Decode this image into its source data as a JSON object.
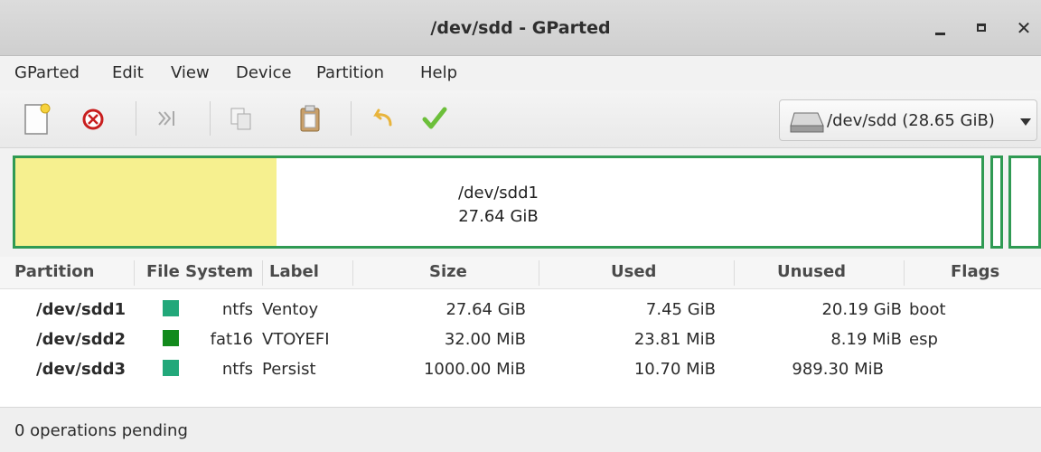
{
  "window": {
    "title": "/dev/sdd - GParted"
  },
  "menu": [
    "GParted",
    "Edit",
    "View",
    "Device",
    "Partition",
    "Help"
  ],
  "toolbar": {
    "buttons": [
      "new-icon",
      "delete-icon",
      "resize-move-icon",
      "copy-icon",
      "paste-icon",
      "undo-icon",
      "apply-icon"
    ],
    "device": "/dev/sdd (28.65 GiB)"
  },
  "graph": {
    "main": {
      "name": "/dev/sdd1",
      "size": "27.64 GiB",
      "used_fraction": 0.27
    }
  },
  "table": {
    "headers": [
      "Partition",
      "File System",
      "Label",
      "Size",
      "Used",
      "Unused",
      "Flags"
    ],
    "rows": [
      {
        "partition": "/dev/sdd1",
        "fs": "ntfs",
        "fs_color": "#22a87a",
        "label": "Ventoy",
        "size": "27.64 GiB",
        "used": "7.45 GiB",
        "unused": "20.19 GiB",
        "flags": "boot"
      },
      {
        "partition": "/dev/sdd2",
        "fs": "fat16",
        "fs_color": "#128a1c",
        "label": "VTOYEFI",
        "size": "32.00 MiB",
        "used": "23.81 MiB",
        "unused": "8.19 MiB",
        "flags": "esp"
      },
      {
        "partition": "/dev/sdd3",
        "fs": "ntfs",
        "fs_color": "#22a87a",
        "label": "Persist",
        "size": "1000.00 MiB",
        "used": "10.70 MiB",
        "unused": "989.30 MiB",
        "flags": ""
      }
    ]
  },
  "status": "0 operations pending",
  "colors": {
    "partition_border": "#2f9a53",
    "used_fill": "#f6f08f"
  }
}
